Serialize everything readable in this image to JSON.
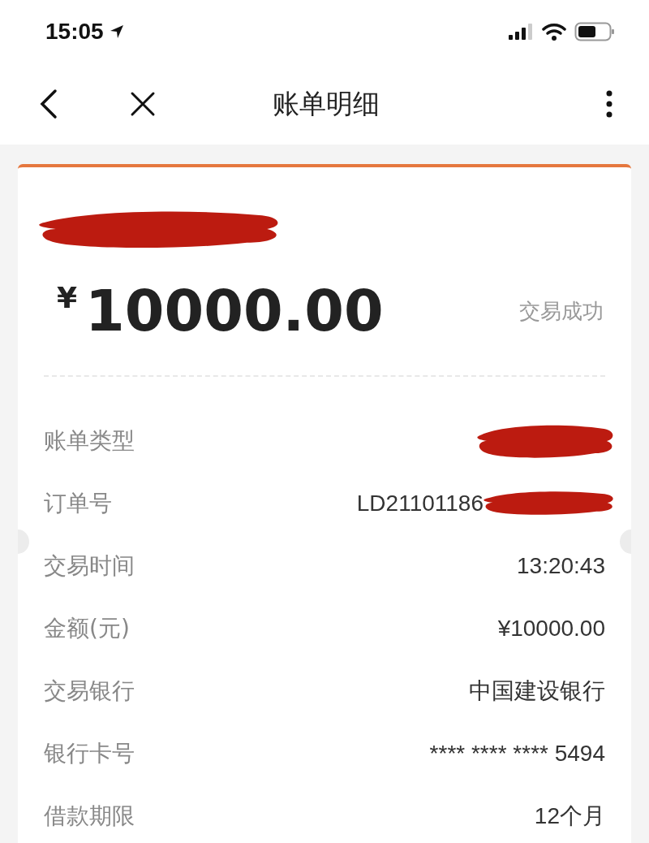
{
  "status_bar": {
    "time": "15:05"
  },
  "nav": {
    "title": "账单明细"
  },
  "summary": {
    "name_redacted": true,
    "currency": "¥",
    "amount": "10000.00",
    "status": "交易成功"
  },
  "rows": [
    {
      "label": "账单类型",
      "redacted": true
    },
    {
      "label": "订单号",
      "value": "LD21101186",
      "redacted": true
    },
    {
      "label": "交易时间",
      "value": "13:20:43",
      "redacted": false
    },
    {
      "label": "金额(元)",
      "value": "¥10000.00",
      "redacted": false
    },
    {
      "label": "交易银行",
      "value": "中国建设银行",
      "redacted": false
    },
    {
      "label": "银行卡号",
      "value": "**** **** **** 5494",
      "redacted": false
    },
    {
      "label": "借款期限",
      "value": "12个月",
      "redacted": false
    }
  ]
}
